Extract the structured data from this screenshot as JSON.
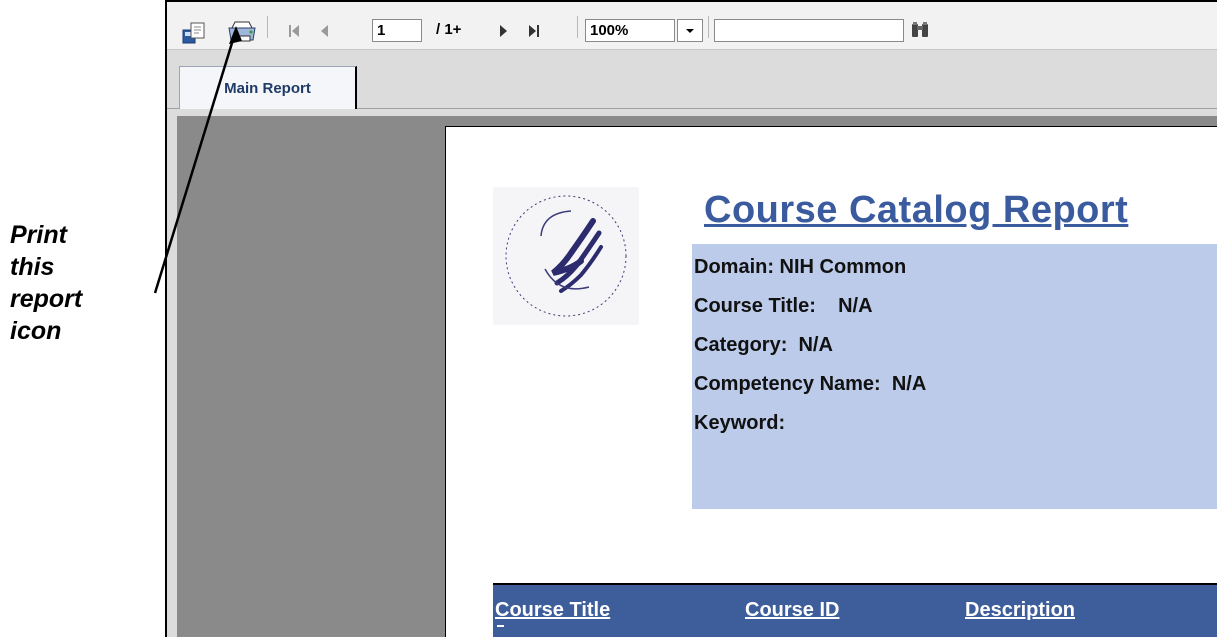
{
  "annotation": {
    "lines": [
      "Print",
      "this",
      "report",
      "icon"
    ]
  },
  "toolbar": {
    "export_icon": "export-icon",
    "print_icon": "printer-icon",
    "first_page_icon": "first-page-icon",
    "prev_page_icon": "previous-page-icon",
    "page_value": "1",
    "page_total": "/ 1+",
    "next_page_icon": "next-page-icon",
    "last_page_icon": "last-page-icon",
    "zoom_value": "100%",
    "search_value": "",
    "search_icon": "binoculars-icon"
  },
  "tabs": [
    {
      "label": "Main Report"
    }
  ],
  "report": {
    "logo_icon": "hhs-seal-icon",
    "title": "Course Catalog Report",
    "criteria": [
      "Domain: NIH Common",
      "Course Title:    N/A",
      "Category:  N/A",
      "Competency Name:  N/A",
      "Keyword:"
    ],
    "columns": [
      "Course Title",
      "Course ID",
      "Description"
    ]
  },
  "colors": {
    "criteria_bg": "#bccbea",
    "header_band": "#3e5e9b",
    "title": "#3a5b9e",
    "canvas": "#8a8a8a"
  }
}
